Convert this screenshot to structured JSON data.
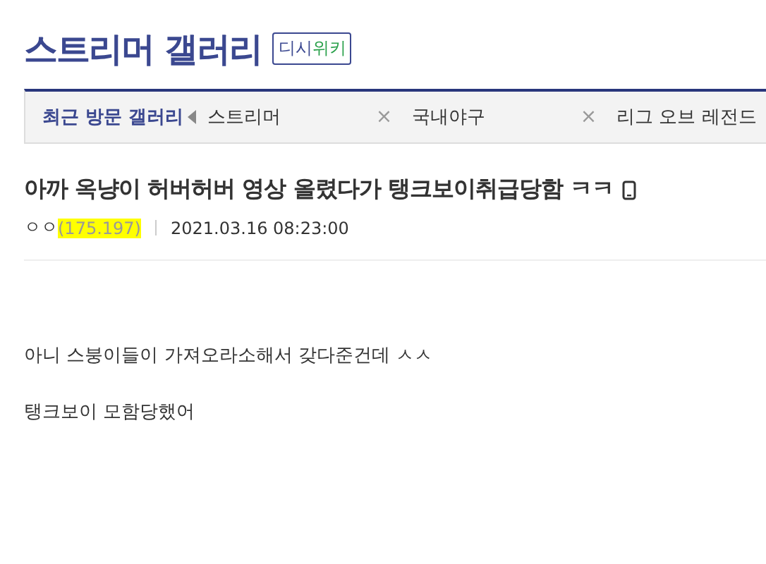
{
  "gallery_title": "스트리머 갤러리",
  "wiki_badge": {
    "part_1": "디시",
    "part_2": "위키"
  },
  "recent_bar": {
    "label": "최근 방문 갤러리",
    "items": [
      {
        "name": "스트리머",
        "close": "×"
      },
      {
        "name": "국내야구",
        "close": "×"
      },
      {
        "name": "리그 오브 레전드"
      }
    ]
  },
  "post": {
    "title": "아까 옥냥이 허버허버 영상 올렸다가 탱크보이취급당함 ㅋㅋ",
    "mobile": true,
    "author": "ㅇㅇ",
    "ip": "(175.197)",
    "ip_highlighted": true,
    "date": "2021.03.16 08:23:00",
    "body": [
      "아니 스붕이들이 가져오라소해서 갖다준건데 ㅅㅅ",
      "탱크보이 모함당했어"
    ]
  }
}
